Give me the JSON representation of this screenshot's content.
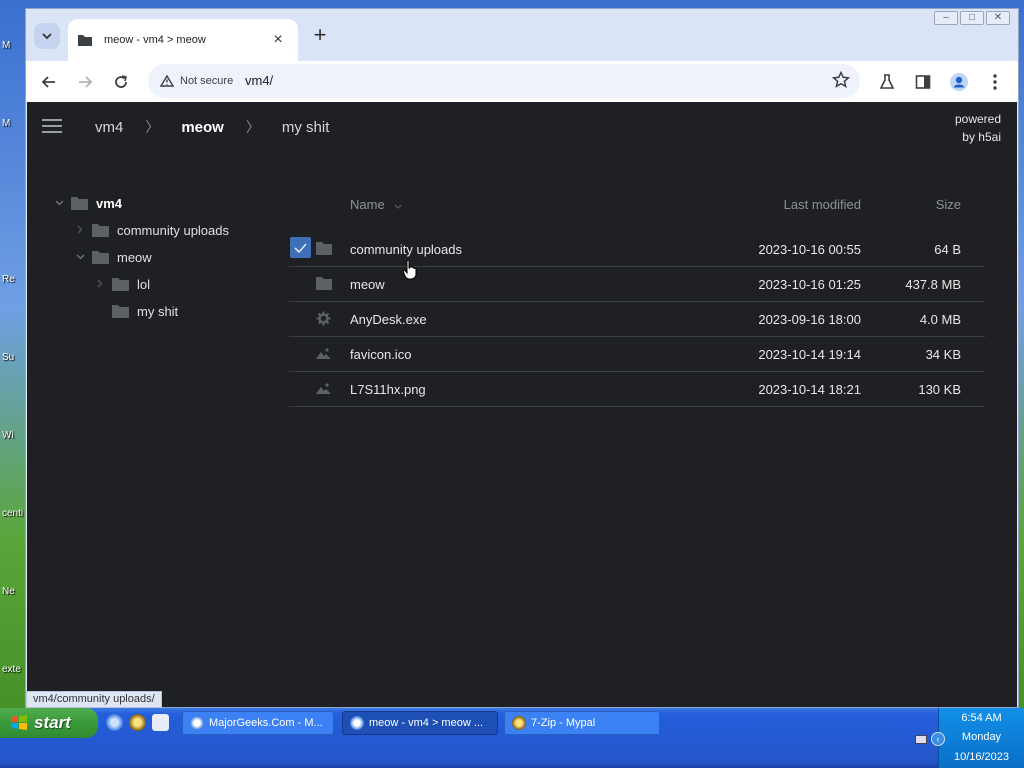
{
  "desktop": {
    "fragments": [
      "M",
      "M",
      "Re",
      "Su",
      "Wi",
      "centi",
      "Ne",
      "exte"
    ]
  },
  "browser": {
    "tab": {
      "title": "meow - vm4 > meow",
      "close": "×"
    },
    "new_tab": "+",
    "window_controls": [
      "‒",
      "□",
      "✕"
    ],
    "security_label": "Not secure",
    "url": "vm4/",
    "status_link": "vm4/community uploads/"
  },
  "app": {
    "breadcrumbs": [
      "vm4",
      "meow",
      "my shit"
    ],
    "powered_by": [
      "powered",
      "by h5ai"
    ],
    "tree": [
      {
        "label": "vm4",
        "level": 0,
        "expanded": true,
        "bold": true
      },
      {
        "label": "community uploads",
        "level": 1,
        "expanded": false,
        "bold": false
      },
      {
        "label": "meow",
        "level": 1,
        "expanded": true,
        "bold": false
      },
      {
        "label": "lol",
        "level": 2,
        "expanded": false,
        "bold": false
      },
      {
        "label": "my shit",
        "level": 2,
        "expanded": null,
        "bold": false
      }
    ],
    "list_headers": {
      "name": "Name",
      "modified": "Last modified",
      "size": "Size"
    },
    "files": [
      {
        "name": "community uploads",
        "modified": "2023-10-16 00:55",
        "size": "64 B",
        "icon": "folder-icon",
        "checked": true
      },
      {
        "name": "meow",
        "modified": "2023-10-16 01:25",
        "size": "437.8 MB",
        "icon": "folder-icon",
        "checked": false
      },
      {
        "name": "AnyDesk.exe",
        "modified": "2023-09-16 18:00",
        "size": "4.0 MB",
        "icon": "gear-icon",
        "checked": false
      },
      {
        "name": "favicon.ico",
        "modified": "2023-10-14 19:14",
        "size": "34 KB",
        "icon": "image-icon",
        "checked": false
      },
      {
        "name": "L7S11hx.png",
        "modified": "2023-10-14 18:21",
        "size": "130 KB",
        "icon": "image-icon",
        "checked": false
      }
    ]
  },
  "taskbar": {
    "start_label": "start",
    "tasks": [
      {
        "label": "MajorGeeks.Com - M...",
        "active": false
      },
      {
        "label": "meow - vm4 > meow ...",
        "active": true
      },
      {
        "label": "7-Zip - Mypal",
        "active": false
      }
    ],
    "clock": {
      "time": "6:54 AM",
      "day": "Monday",
      "date": "10/16/2023"
    }
  },
  "colors": {
    "page_bg": "#1e2023",
    "checkbox": "#3f6fb8",
    "taskbar": "#245edb",
    "start": "#3a9a3a"
  }
}
